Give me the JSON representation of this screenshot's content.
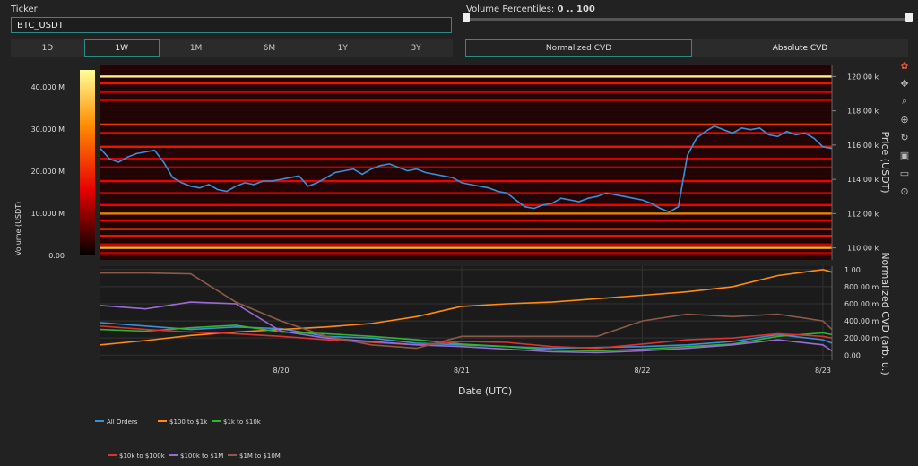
{
  "controls": {
    "ticker_label": "Ticker",
    "ticker_value": "BTC_USDT",
    "percentile_label": "Volume Percentiles:",
    "percentile_value": "0 .. 100",
    "timeframes": [
      "1D",
      "1W",
      "1M",
      "6M",
      "1Y",
      "3Y"
    ],
    "active_timeframe": "1W",
    "cvd_modes": [
      "Normalized CVD",
      "Absolute CVD"
    ],
    "active_cvd_mode": "Normalized CVD"
  },
  "modebar_icons": [
    "plotly-logo-icon",
    "pan-icon",
    "zoom-icon",
    "zoom-select-icon",
    "reset-icon",
    "download-icon",
    "hover-compare-icon",
    "spike-lines-icon"
  ],
  "colors": {
    "price_line": "#3a8fd9",
    "accent": "#2e8b85",
    "background": "#222222"
  },
  "chart_data": [
    {
      "type": "heatmap",
      "title": "",
      "colorscale": "hot",
      "colorbar_label": "Volume (USDT)",
      "colorbar_ticks": [
        "0.00",
        "10.000 M",
        "20.000 M",
        "30.000 M",
        "40.000 M"
      ],
      "colorbar_range": [
        0,
        44000000
      ],
      "ylabel": "Price (USDT)",
      "ylim": [
        109300,
        120700
      ],
      "yticks": [
        110000,
        112000,
        114000,
        116000,
        118000,
        120000
      ],
      "ytick_labels": [
        "110.00 k",
        "112.00 k",
        "114.00 k",
        "116.00 k",
        "118.00 k",
        "120.00 k"
      ],
      "xlim": [
        0,
        4.05
      ],
      "price_series": {
        "name": "Price",
        "x": [
          0,
          0.05,
          0.1,
          0.15,
          0.2,
          0.25,
          0.3,
          0.35,
          0.4,
          0.45,
          0.5,
          0.55,
          0.6,
          0.65,
          0.7,
          0.75,
          0.8,
          0.85,
          0.9,
          0.95,
          1.0,
          1.05,
          1.1,
          1.15,
          1.2,
          1.25,
          1.3,
          1.35,
          1.4,
          1.45,
          1.5,
          1.55,
          1.6,
          1.65,
          1.7,
          1.75,
          1.8,
          1.85,
          1.9,
          1.95,
          2.0,
          2.05,
          2.1,
          2.15,
          2.2,
          2.25,
          2.3,
          2.35,
          2.4,
          2.45,
          2.5,
          2.55,
          2.6,
          2.65,
          2.7,
          2.75,
          2.8,
          2.85,
          2.9,
          2.95,
          3.0,
          3.05,
          3.1,
          3.15,
          3.2,
          3.25,
          3.3,
          3.35,
          3.4,
          3.45,
          3.5,
          3.55,
          3.6,
          3.65,
          3.7,
          3.75,
          3.8,
          3.85,
          3.9,
          3.95,
          4.0,
          4.05
        ],
        "y": [
          115800,
          115200,
          115000,
          115300,
          115500,
          115600,
          115700,
          115000,
          114100,
          113800,
          113600,
          113500,
          113700,
          113400,
          113300,
          113600,
          113800,
          113700,
          113900,
          113900,
          114000,
          114100,
          114200,
          113600,
          113800,
          114100,
          114400,
          114500,
          114600,
          114300,
          114600,
          114800,
          114900,
          114700,
          114500,
          114600,
          114400,
          114300,
          114200,
          114100,
          113800,
          113700,
          113600,
          113500,
          113300,
          113200,
          112800,
          112400,
          112300,
          112500,
          112600,
          112900,
          112800,
          112700,
          112900,
          113000,
          113200,
          113100,
          113000,
          112900,
          112800,
          112600,
          112300,
          112100,
          112400,
          115400,
          116400,
          116800,
          117100,
          116900,
          116700,
          117000,
          116900,
          117000,
          116600,
          116500,
          116800,
          116600,
          116700,
          116400,
          115900,
          115800
        ]
      },
      "volume_levels": [
        {
          "price": 120000,
          "volume": 42000000
        },
        {
          "price": 119600,
          "volume": 18000000
        },
        {
          "price": 119100,
          "volume": 14000000
        },
        {
          "price": 118600,
          "volume": 12000000
        },
        {
          "price": 117200,
          "volume": 22000000
        },
        {
          "price": 116700,
          "volume": 16000000
        },
        {
          "price": 115900,
          "volume": 18000000
        },
        {
          "price": 115200,
          "volume": 14000000
        },
        {
          "price": 114700,
          "volume": 12000000
        },
        {
          "price": 113900,
          "volume": 16000000
        },
        {
          "price": 113200,
          "volume": 12000000
        },
        {
          "price": 112500,
          "volume": 16000000
        },
        {
          "price": 112000,
          "volume": 30000000
        },
        {
          "price": 111600,
          "volume": 16000000
        },
        {
          "price": 111100,
          "volume": 22000000
        },
        {
          "price": 110700,
          "volume": 18000000
        },
        {
          "price": 110200,
          "volume": 14000000
        },
        {
          "price": 110000,
          "volume": 34000000
        },
        {
          "price": 109700,
          "volume": 12000000
        }
      ]
    },
    {
      "type": "line",
      "title": "",
      "xlabel": "Date (UTC)",
      "ylabel": "Normalized CVD (arb. u.)",
      "ylim": [
        -0.06,
        1.04
      ],
      "yticks": [
        0,
        0.2,
        0.4,
        0.6,
        0.8,
        1.0
      ],
      "ytick_labels": [
        "0.00",
        "200.00 m",
        "400.00 m",
        "600.00 m",
        "800.00 m",
        "1.00"
      ],
      "xlim": [
        0,
        4.05
      ],
      "x_ticks": [
        1,
        2,
        3,
        4
      ],
      "x_tick_labels": [
        "8/20",
        "8/21",
        "8/22",
        "8/23"
      ],
      "legend_placement": "bottom-left",
      "x": [
        0,
        0.25,
        0.5,
        0.75,
        1.0,
        1.25,
        1.5,
        1.75,
        2.0,
        2.25,
        2.5,
        2.75,
        3.0,
        3.25,
        3.5,
        3.75,
        4.0,
        4.05
      ],
      "series": [
        {
          "name": "All Orders",
          "color": "#3a8fd9",
          "values": [
            0.38,
            0.34,
            0.3,
            0.33,
            0.31,
            0.22,
            0.2,
            0.14,
            0.12,
            0.1,
            0.08,
            0.09,
            0.1,
            0.12,
            0.16,
            0.24,
            0.18,
            0.14
          ]
        },
        {
          "name": "$100 to $1k",
          "color": "#ff8a14",
          "values": [
            0.12,
            0.17,
            0.23,
            0.27,
            0.3,
            0.33,
            0.37,
            0.45,
            0.57,
            0.6,
            0.62,
            0.66,
            0.7,
            0.74,
            0.8,
            0.93,
            1.0,
            0.97
          ]
        },
        {
          "name": "$1k to $10k",
          "color": "#2fb52f",
          "values": [
            0.3,
            0.28,
            0.32,
            0.35,
            0.27,
            0.25,
            0.22,
            0.18,
            0.13,
            0.1,
            0.06,
            0.05,
            0.07,
            0.1,
            0.13,
            0.22,
            0.26,
            0.24
          ]
        },
        {
          "name": "$10k to $100k",
          "color": "#d93333",
          "values": [
            0.34,
            0.3,
            0.27,
            0.25,
            0.22,
            0.18,
            0.15,
            0.12,
            0.16,
            0.15,
            0.1,
            0.08,
            0.13,
            0.18,
            0.2,
            0.25,
            0.22,
            0.2
          ]
        },
        {
          "name": "$100k to $1M",
          "color": "#9b6bd4",
          "values": [
            0.58,
            0.54,
            0.62,
            0.6,
            0.28,
            0.2,
            0.16,
            0.12,
            0.1,
            0.07,
            0.04,
            0.03,
            0.05,
            0.08,
            0.12,
            0.18,
            0.12,
            0.05
          ]
        },
        {
          "name": "$1M to $10M",
          "color": "#8c5a4a",
          "values": [
            0.96,
            0.96,
            0.95,
            0.62,
            0.4,
            0.22,
            0.12,
            0.08,
            0.22,
            0.22,
            0.22,
            0.22,
            0.4,
            0.48,
            0.45,
            0.48,
            0.4,
            0.3
          ]
        }
      ]
    }
  ]
}
